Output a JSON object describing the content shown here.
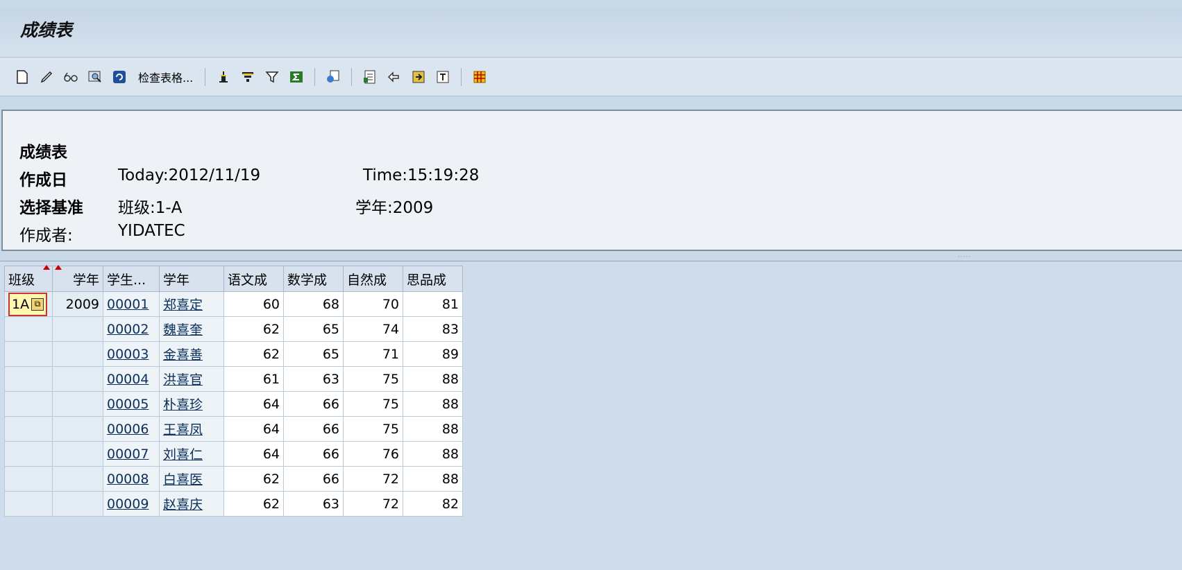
{
  "window": {
    "title": "成绩表"
  },
  "toolbar": {
    "check_table_label": "检查表格...",
    "icons": [
      "new-icon",
      "edit-icon",
      "glasses-icon",
      "find-icon",
      "refresh-icon",
      "sort-asc-icon",
      "filter-icon",
      "filter-set-icon",
      "sum-icon",
      "export-icon",
      "spreadsheet-icon",
      "layout-icon",
      "save-icon",
      "abc-icon",
      "grid-icon"
    ]
  },
  "report": {
    "title": "成绩表",
    "created_label": "作成日",
    "created_value": "Today:2012/11/19",
    "time_value": "Time:15:19:28",
    "criteria_label": "选择基准",
    "class_value": "班级:1-A",
    "year_value": "学年:2009",
    "author_label": "作成者:",
    "author_value": "YIDATEC"
  },
  "grid": {
    "headers": [
      "班级",
      "学年",
      "学生...",
      "学年",
      "语文成",
      "数学成",
      "自然成",
      "思品成"
    ],
    "class_value": "1A",
    "year_value": "2009",
    "rows": [
      [
        "00001",
        "郑喜定",
        "60",
        "68",
        "70",
        "81"
      ],
      [
        "00002",
        "魏喜奎",
        "62",
        "65",
        "74",
        "83"
      ],
      [
        "00003",
        "金喜善",
        "62",
        "65",
        "71",
        "89"
      ],
      [
        "00004",
        "洪喜官",
        "61",
        "63",
        "75",
        "88"
      ],
      [
        "00005",
        "朴喜珍",
        "64",
        "66",
        "75",
        "88"
      ],
      [
        "00006",
        "王喜凤",
        "64",
        "66",
        "75",
        "88"
      ],
      [
        "00007",
        "刘喜仁",
        "64",
        "66",
        "76",
        "88"
      ],
      [
        "00008",
        "白喜医",
        "62",
        "66",
        "72",
        "88"
      ],
      [
        "00009",
        "赵喜庆",
        "62",
        "63",
        "72",
        "82"
      ]
    ]
  }
}
